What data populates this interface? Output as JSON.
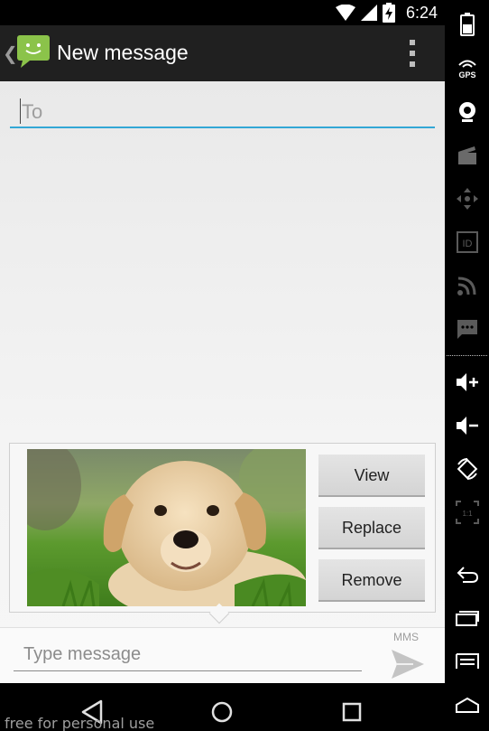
{
  "status_bar": {
    "time": "6:24",
    "icons": [
      "wifi-icon",
      "signal-icon",
      "battery-charging-icon"
    ]
  },
  "action_bar": {
    "title": "New message",
    "icons": [
      "back-caret-icon",
      "messaging-app-icon",
      "overflow-menu-icon"
    ]
  },
  "recipient": {
    "placeholder": "To",
    "value": ""
  },
  "attachment": {
    "image": "puppy-photo",
    "buttons": {
      "view": "View",
      "replace": "Replace",
      "remove": "Remove"
    }
  },
  "compose": {
    "placeholder": "Type message",
    "value": "",
    "mode_label": "MMS",
    "send_icon": "send-icon"
  },
  "nav_bar": {
    "buttons": [
      "back-icon",
      "home-icon",
      "recents-icon"
    ],
    "watermark": "free for personal use"
  },
  "side_panel": {
    "buttons": [
      "battery-icon",
      "gps-icon",
      "camera-icon",
      "media-icon",
      "dpad-icon",
      "device-id-icon",
      "network-rss-icon",
      "sms-icon",
      "volume-up-icon",
      "volume-down-icon",
      "rotate-icon",
      "scale-icon",
      "back-icon",
      "recent-apps-icon",
      "menu-icon",
      "home-icon"
    ],
    "gps_label": "GPS",
    "id_label": "ID",
    "scale_label": "1:1"
  },
  "colors": {
    "accent": "#33a7d6",
    "action_bar": "#202020",
    "background": "#f2f2f2",
    "app_icon": "#8bc34a"
  }
}
